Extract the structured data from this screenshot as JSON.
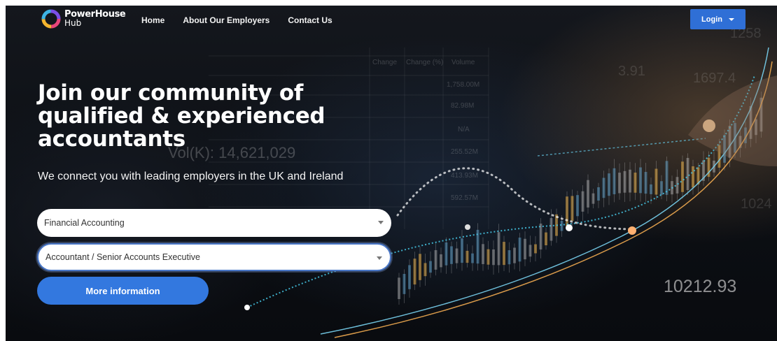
{
  "brand": {
    "name": "PowerHouse",
    "sub": "Hub"
  },
  "nav": {
    "items": [
      {
        "label": "Home"
      },
      {
        "label": "About Our Employers"
      },
      {
        "label": "Contact Us"
      }
    ],
    "login_label": "Login"
  },
  "hero": {
    "headline": "Join our community of\nqualified & experienced\naccountants",
    "subline": "We connect you with leading employers in the UK and Ireland",
    "select_area": {
      "value": "Financial Accounting"
    },
    "select_role": {
      "value": "Accountant / Senior Accounts Executive"
    },
    "cta_label": "More information"
  },
  "background_text": {
    "table_headers": [
      "Change",
      "Change (%)",
      "Volume"
    ],
    "volumes": [
      "1,758.00M",
      "82.98M",
      "N/A",
      "255.52M",
      "413.93M",
      "592.57M"
    ],
    "vol_label": "Vol(K): 14,621,029",
    "big_number": "10212.93",
    "right_numbers": [
      "1258",
      "1697.4",
      "3.91",
      "1024"
    ]
  },
  "colors": {
    "primary": "#3378df",
    "login": "#2f6fd6",
    "background": "#0c0f14"
  }
}
